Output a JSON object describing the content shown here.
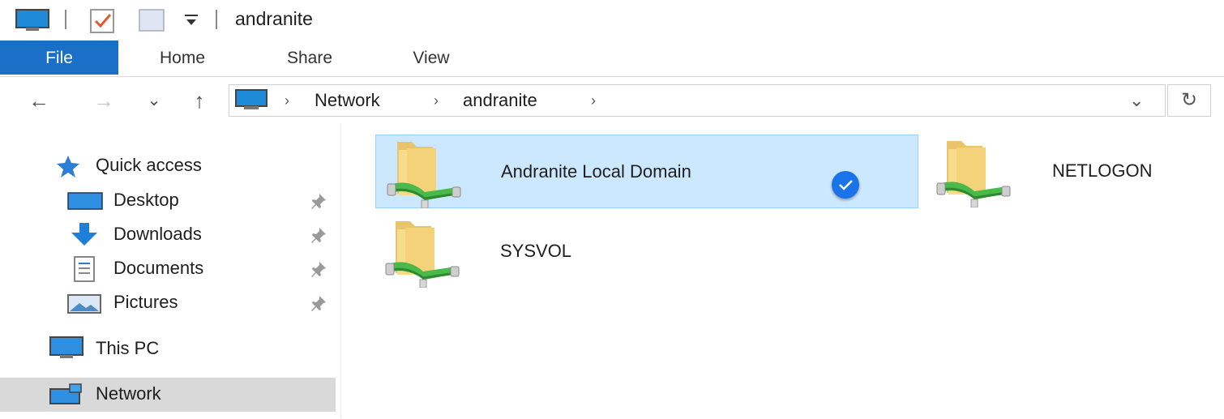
{
  "window": {
    "title": "andranite"
  },
  "ribbon": {
    "tabs": [
      {
        "label": "File"
      },
      {
        "label": "Home"
      },
      {
        "label": "Share"
      },
      {
        "label": "View"
      }
    ]
  },
  "navigation": {
    "back_label": "←",
    "forward_label": "→",
    "recent_label": "⌄",
    "up_label": "↑",
    "refresh_label": "↻",
    "breadcrumb": [
      "Network",
      "andranite"
    ],
    "separator": "›",
    "dropdown_label": "⌄"
  },
  "sidebar": {
    "quick_access": "Quick access",
    "items": [
      {
        "label": "Desktop",
        "icon": "desktop-icon",
        "pinned": true
      },
      {
        "label": "Downloads",
        "icon": "downloads-icon",
        "pinned": true
      },
      {
        "label": "Documents",
        "icon": "documents-icon",
        "pinned": true
      },
      {
        "label": "Pictures",
        "icon": "pictures-icon",
        "pinned": true
      }
    ],
    "this_pc": "This PC",
    "network": "Network"
  },
  "content": {
    "items": [
      {
        "name": "Andranite Local Domain",
        "selected": true,
        "icon": "network-share-folder-icon"
      },
      {
        "name": "NETLOGON",
        "selected": false,
        "icon": "network-share-folder-icon"
      },
      {
        "name": "SYSVOL",
        "selected": false,
        "icon": "network-share-folder-icon"
      }
    ]
  },
  "colors": {
    "file_tab": "#1a6fc7",
    "selection_fill": "#cce8ff",
    "selection_border": "#99d1ff",
    "check_badge": "#1a73e8",
    "nav_selected": "#d9d9d9"
  }
}
